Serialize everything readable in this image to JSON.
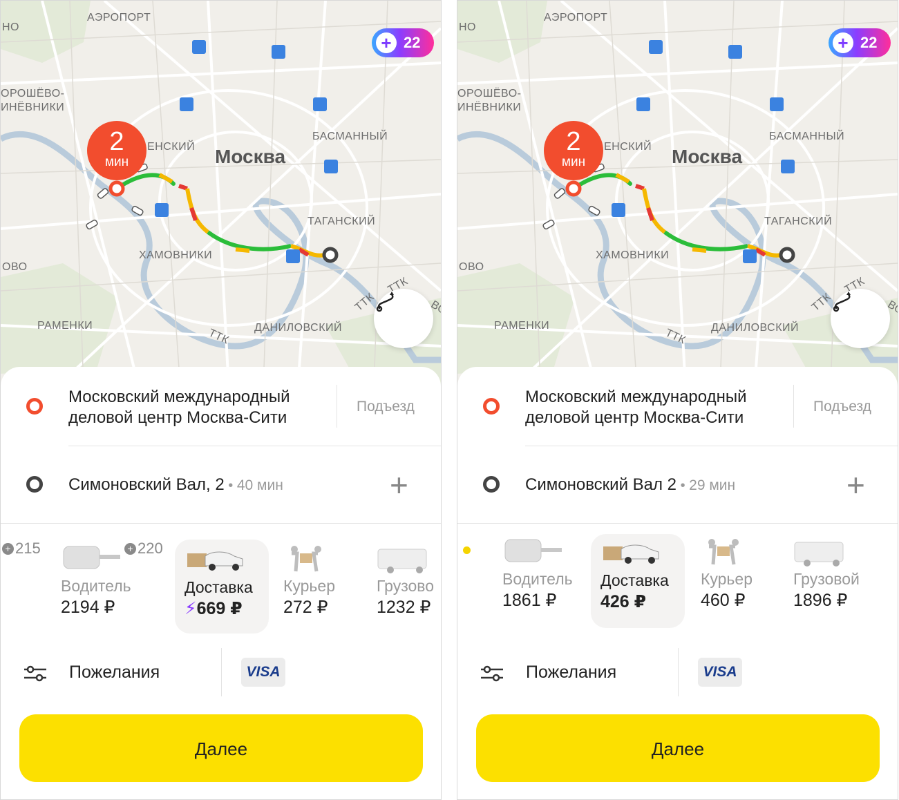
{
  "screens": [
    {
      "plus_points": "22",
      "eta": {
        "value": "2",
        "unit": "мин"
      },
      "map_labels": {
        "airport": "АЭРОПОРТ",
        "khoroshevo": "ОРОШЁВО-",
        "mnevniki": "ИНЁВНИКИ",
        "presnensky": "ЕНСКИЙ",
        "moscow": "Москва",
        "basmanny": "БАСМАННЫЙ",
        "tagansky": "ТАГАНСКИЙ",
        "khamovniki": "ХАМОВНИКИ",
        "ramenki": "РАМЕНКИ",
        "danilovsky": "ДАНИЛОВСКИЙ",
        "ttk1": "ТТК",
        "ttk2": "ТТК",
        "ttk3": "ТТК",
        "vo": "ОВО",
        "ho": "НО",
        "vo2": "ВО"
      },
      "from_address": "Московский международный деловой центр Москва-Сити",
      "from_address_line1": "Московский международный",
      "from_address_line2": "деловой центр Москва-Сити",
      "entrance_label": "Подъезд",
      "to_address": "Симоновский Вал, 2",
      "to_time": "40 мин",
      "cashback": [
        {
          "value": "215"
        },
        {
          "value": "220"
        }
      ],
      "tariffs": [
        {
          "name": "Водитель",
          "price": "2194 ₽",
          "selected": false
        },
        {
          "name": "Доставка",
          "price": "669 ₽",
          "selected": true,
          "surge": true
        },
        {
          "name": "Курьер",
          "price": "272 ₽",
          "selected": false
        },
        {
          "name": "Грузово",
          "price": "1232 ₽",
          "selected": false
        }
      ],
      "wishes_label": "Пожелания",
      "payment": "VISA",
      "next_label": "Далее"
    },
    {
      "plus_points": "22",
      "eta": {
        "value": "2",
        "unit": "мин"
      },
      "map_labels": {
        "airport": "АЭРОПОРТ",
        "khoroshevo": "ОРОШЁВО-",
        "mnevniki": "ИНЁВНИКИ",
        "presnensky": "ЕНСКИЙ",
        "moscow": "Москва",
        "basmanny": "БАСМАННЫЙ",
        "tagansky": "ТАГАНСКИЙ",
        "khamovniki": "ХАМОВНИКИ",
        "ramenki": "РАМЕНКИ",
        "danilovsky": "ДАНИЛОВСКИЙ",
        "ttk1": "ТТК",
        "ttk2": "ТТК",
        "ttk3": "ТТК",
        "vo": "ОВО",
        "ho": "НО",
        "vo2": "ВО"
      },
      "from_address_line1": "Московский международный",
      "from_address_line2": "деловой центр Москва-Сити",
      "entrance_label": "Подъезд",
      "to_address": "Симоновский Вал 2",
      "to_time": "29 мин",
      "tariffs": [
        {
          "name": "Водитель",
          "price": "1861 ₽",
          "selected": false
        },
        {
          "name": "Доставка",
          "price": "426 ₽",
          "selected": true
        },
        {
          "name": "Курьер",
          "price": "460 ₽",
          "selected": false
        },
        {
          "name": "Грузовой",
          "price": "1896 ₽",
          "selected": false
        }
      ],
      "wishes_label": "Пожелания",
      "payment": "VISA",
      "next_label": "Далее"
    }
  ],
  "colors": {
    "accent_yellow": "#fce000",
    "route_green": "#2bbd3a",
    "route_yellow": "#f5b800",
    "route_red": "#e53935",
    "pin_red": "#f24d2e"
  }
}
